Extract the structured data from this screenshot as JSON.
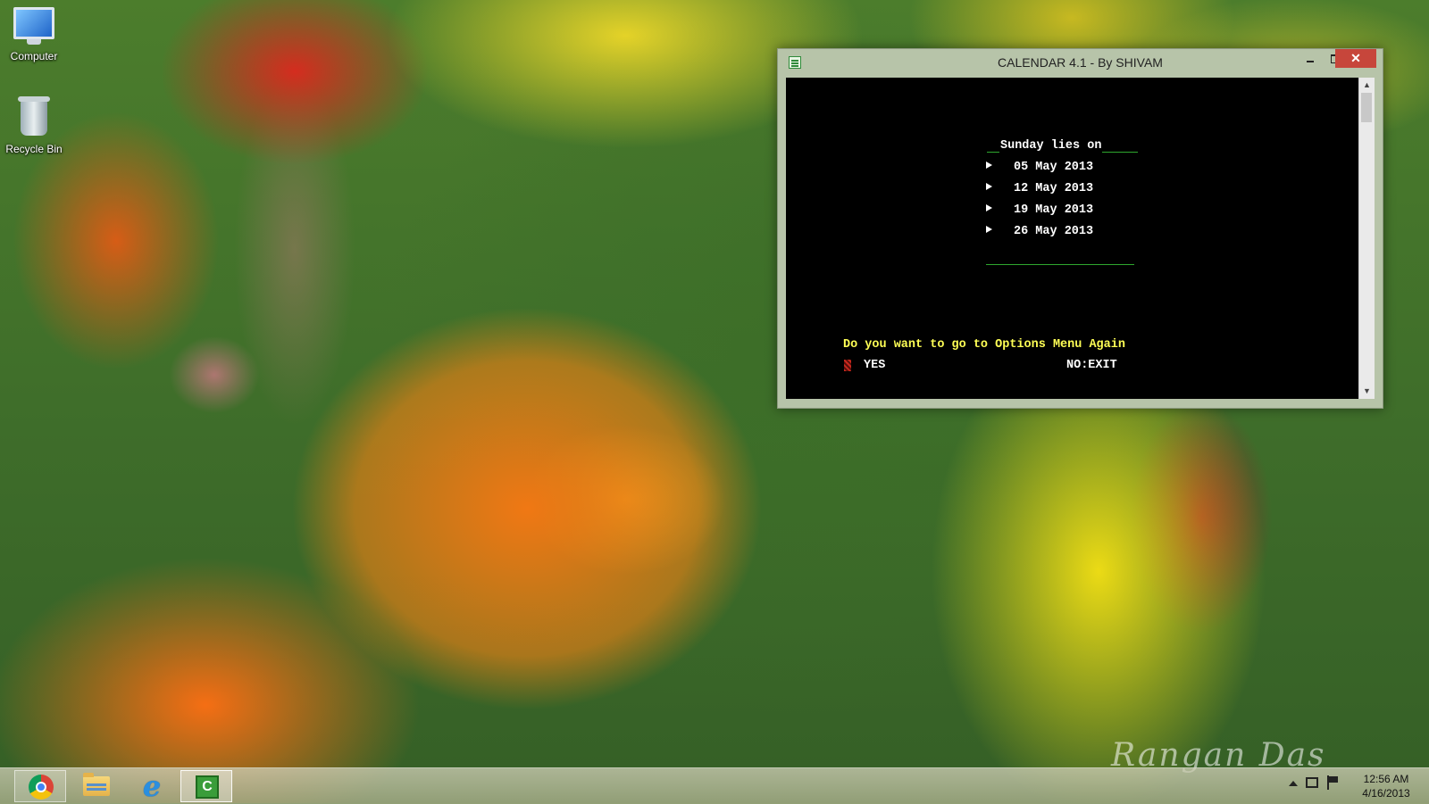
{
  "desktop": {
    "icons": [
      {
        "label": "Computer"
      },
      {
        "label": "Recycle Bin"
      }
    ]
  },
  "window": {
    "title": "CALENDAR 4.1 - By SHIVAM",
    "close_glyph": "✕"
  },
  "console": {
    "heading": "Sunday lies on",
    "dates": [
      "05 May 2013",
      "12 May 2013",
      "19 May 2013",
      "26 May 2013"
    ],
    "prompt": "Do you want to go to Options Menu Again",
    "option_yes": "YES",
    "option_no": "NO:EXIT",
    "colors": {
      "text": "#ffffff",
      "prompt": "#ffff55",
      "rule": "#2fa82f",
      "marker": "#c8281e"
    }
  },
  "taskbar": {
    "items": [
      {
        "icon": "chrome-icon"
      },
      {
        "icon": "file-explorer-icon"
      },
      {
        "icon": "internet-explorer-icon",
        "glyph": "e"
      },
      {
        "icon": "calendar-app-icon",
        "glyph": "C"
      }
    ],
    "clock": {
      "time": "12:56 AM",
      "date": "4/16/2013"
    }
  },
  "wallpaper": {
    "signature": "Rangan Das"
  }
}
